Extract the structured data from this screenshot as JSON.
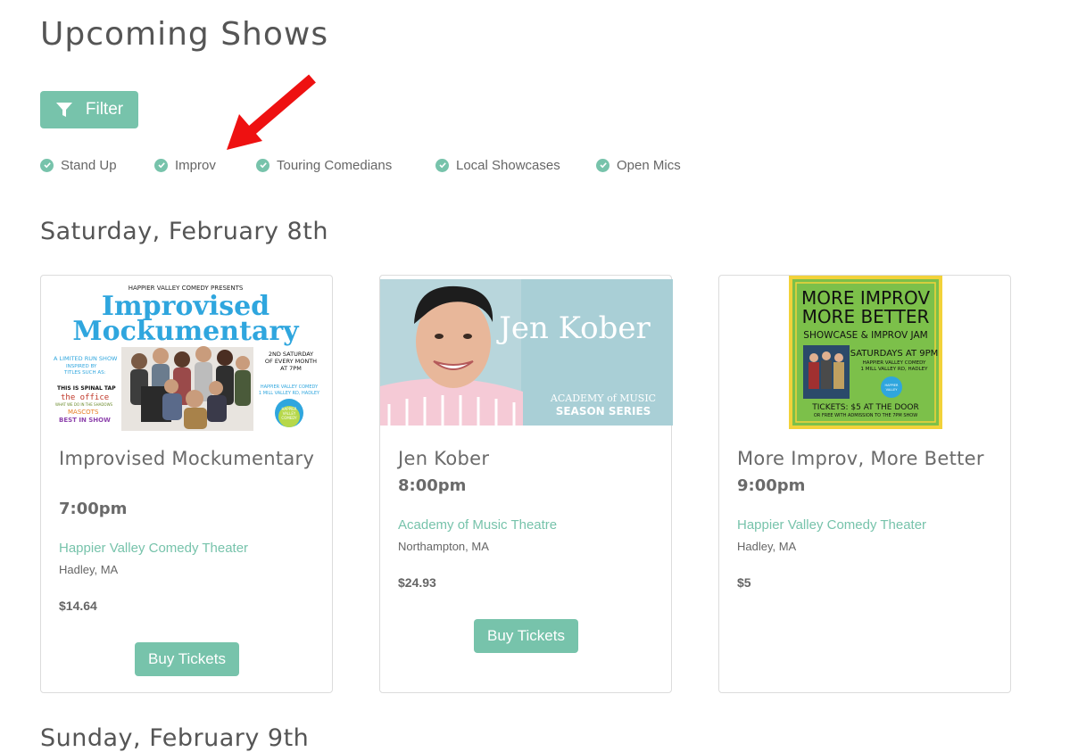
{
  "header": {
    "title": "Upcoming Shows"
  },
  "filter": {
    "label": "Filter"
  },
  "categories": [
    {
      "label": "Stand Up",
      "checked": true
    },
    {
      "label": "Improv",
      "checked": true
    },
    {
      "label": "Touring Comedians",
      "checked": true
    },
    {
      "label": "Local Showcases",
      "checked": true
    },
    {
      "label": "Open Mics",
      "checked": true
    }
  ],
  "days": [
    {
      "date": "Saturday, February 8th",
      "shows": [
        {
          "title": "Improvised Mockumentary",
          "time": "7:00pm",
          "venue": "Happier Valley Comedy Theater",
          "city": "Hadley, MA",
          "price": "$14.64",
          "button": "Buy Tickets",
          "poster": {
            "presenter": "HAPPIER VALLEY COMEDY PRESENTS",
            "line1": "Improvised",
            "line2": "Mockumentary",
            "left1": "A LIMITED RUN SHOW",
            "left2": "INSPIRED BY",
            "left3": "TITLES SUCH AS:",
            "t1": "THIS IS SPINAL TAP",
            "t2": "the office",
            "t3": "WHAT WE DO IN THE SHADOWS",
            "t4": "MASCOTS",
            "t5": "BEST IN SHOW",
            "right1": "2ND SATURDAY",
            "right2": "OF EVERY MONTH",
            "right3": "AT 7PM",
            "right4": "HAPPIER VALLEY COMEDY",
            "right5": "1 MILL VALLEY RD, HADLEY",
            "logo": "HAPPIER VALLEY COMEDY"
          }
        },
        {
          "title": "Jen Kober",
          "time": "8:00pm",
          "venue": "Academy of Music Theatre",
          "city": "Northampton, MA",
          "price": "$24.93",
          "button": "Buy Tickets",
          "poster": {
            "name": "Jen Kober",
            "brand": "ACADEMY of MUSIC",
            "series": "SEASON SERIES"
          }
        },
        {
          "title": "More Improv, More Better",
          "time": "9:00pm",
          "venue": "Happier Valley Comedy Theater",
          "city": "Hadley, MA",
          "price": "$5",
          "button": "",
          "poster": {
            "line1": "MORE IMPROV",
            "line2": "MORE BETTER",
            "line3": "SHOWCASE & IMPROV JAM",
            "when": "SATURDAYS AT 9PM",
            "venue1": "HAPPIER VALLEY COMEDY",
            "venue2": "1 MILL VALLEY RD, HADLEY",
            "tickets": "TICKETS: $5 AT THE DOOR",
            "note": "OR FREE WITH ADMISSION TO THE 7PM SHOW",
            "logo": "HAPPIER VALLEY COMEDY"
          }
        }
      ]
    },
    {
      "date": "Sunday, February 9th",
      "shows": []
    }
  ],
  "colors": {
    "accent": "#77c3ab",
    "arrow": "#ee1111"
  }
}
